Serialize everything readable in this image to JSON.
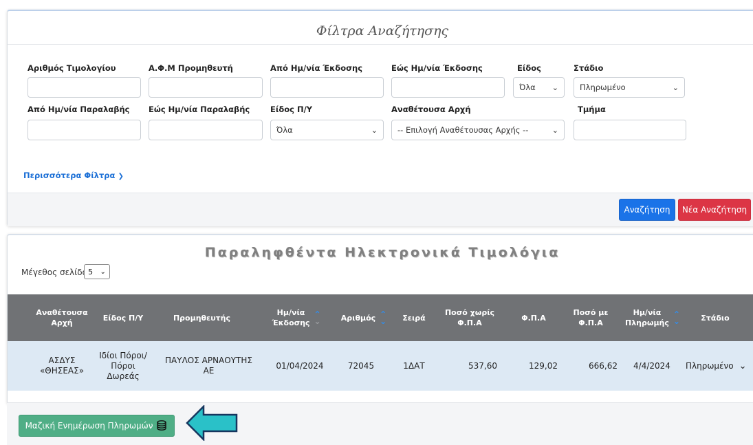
{
  "filters": {
    "title": "Φίλτρα Αναζήτησης",
    "invoice_number_label": "Αριθμός Τιμολογίου",
    "supplier_afm_label": "Α.Φ.Μ Προμηθευτή",
    "issue_date_from_label": "Από Ημ/νία Έκδοσης",
    "issue_date_to_label": "Εώς Ημ/νία Έκδοσης",
    "type_label": "Είδος",
    "type_value": "Όλα",
    "stage_label": "Στάδιο",
    "stage_value": "Πληρωμένο",
    "receipt_date_from_label": "Από Ημ/νία Παραλαβής",
    "receipt_date_to_label": "Εώς Ημ/νία Παραλαβής",
    "budget_type_label": "Είδος Π/Υ",
    "budget_type_value": "Όλα",
    "authority_label": "Αναθέτουσα Αρχή",
    "authority_value": "-- Επιλογή Αναθέτουσας Αρχής --",
    "department_label": "Τμήμα",
    "more_filters": "Περισσότερα Φίλτρα",
    "search_button": "Αναζήτηση",
    "new_search_button": "Νέα Αναζήτηση"
  },
  "results": {
    "title": "Παραληφθέντα Ηλεκτρονικά Τιμολόγια",
    "page_size_label": "Μέγεθος σελίδα",
    "page_size_value": "5",
    "columns": {
      "authority": [
        "Αναθέτουσα",
        "Αρχή"
      ],
      "budget_type": "Είδος Π/Υ",
      "supplier": "Προμηθευτής",
      "issue_date": [
        "Ημ/νία",
        "Έκδοσης"
      ],
      "number": "Αριθμός",
      "series": "Σειρά",
      "amount_net": [
        "Ποσό χωρίς",
        "Φ.Π.Α"
      ],
      "vat": "Φ.Π.Α",
      "amount_gross": [
        "Ποσό με",
        "Φ.Π.Α"
      ],
      "payment_date": [
        "Ημ/νία",
        "Πληρωμής"
      ],
      "stage": "Στάδιο"
    },
    "rows": [
      {
        "authority": [
          "ΑΣΔΥΣ",
          "«ΘΗΣΕΑΣ»"
        ],
        "budget_type": [
          "Ιδίοι Πόροι/",
          "Πόροι",
          "Δωρεάς"
        ],
        "supplier": "ΠΑΥΛΟΣ ΑΡΝΑΟΥΤΗΣ ΑΕ",
        "issue_date": "01/04/2024",
        "number": "72045",
        "series": "1ΔΑΤ",
        "amount_net": "537,60",
        "vat": "129,02",
        "amount_gross": "666,62",
        "payment_date": "4/4/2024",
        "stage": "Πληρωμένο"
      }
    ]
  },
  "bottom": {
    "mass_update_button": "Μαζική Ενημέρωση Πληρωμών"
  },
  "colors": {
    "primary": "#1a73e8",
    "danger": "#dc3545",
    "success": "#4fae86",
    "table_header": "#707275",
    "row_background": "#dde9f4",
    "annotation_arrow": "#2ac1c8"
  },
  "icons": {
    "chevron": "chevron-down-icon",
    "coins": "coins-icon",
    "sort": "sort-icon",
    "annotation": "arrow-left-icon"
  }
}
